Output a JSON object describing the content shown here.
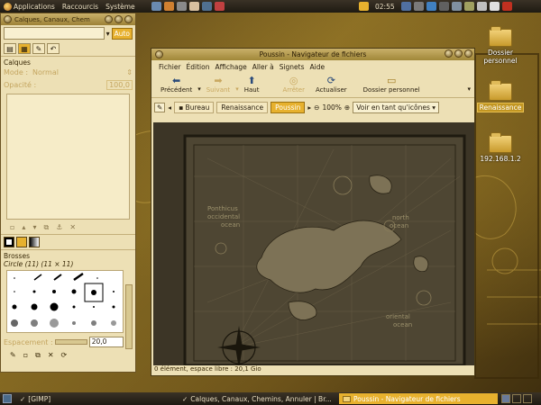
{
  "top_panel": {
    "applications": "Applications",
    "places": "Raccourcis",
    "system": "Système",
    "clock": "02:55"
  },
  "desktop": {
    "icons": [
      {
        "label": "Dossier personnel"
      },
      {
        "label": "Renaissance"
      },
      {
        "label": "192.168.1.2"
      }
    ]
  },
  "gimp_dock": {
    "title": "Calques, Canaux, Chem",
    "auto_label": "Auto",
    "layers_title": "Calques",
    "mode_label": "Mode :",
    "mode_value": "Normal",
    "opacity_label": "Opacité :",
    "opacity_value": "100,0",
    "brushes_title": "Brosses",
    "brush_name": "Circle (11) (11 × 11)",
    "spacing_label": "Espacement :",
    "spacing_value": "20,0"
  },
  "file_manager": {
    "title": "Poussin - Navigateur de fichiers",
    "menu": [
      "Fichier",
      "Édition",
      "Affichage",
      "Aller à",
      "Signets",
      "Aide"
    ],
    "toolbar": {
      "back": "Précédent",
      "forward": "Suivant",
      "up": "Haut",
      "stop": "Arrêter",
      "reload": "Actualiser",
      "home": "Dossier personnel"
    },
    "crumbs": [
      "Bureau",
      "Renaissance",
      "Poussin"
    ],
    "zoom": "100%",
    "view_mode": "Voir en tant qu'icônes",
    "status": "0 élément, espace libre : 20,1 Gio",
    "map_labels": [
      "Ponthicus",
      "occidental",
      "ocean",
      "oriental",
      "north",
      "ocean",
      "ocean",
      "ocean"
    ]
  },
  "bottom_panel": {
    "tasks": [
      {
        "label": "[GIMP]"
      },
      {
        "label": "Calques, Canaux, Chemins, Annuler | Br..."
      },
      {
        "label": "Poussin - Navigateur de fichiers"
      }
    ]
  },
  "colors": {
    "accent": "#e7b12e",
    "panel": "#1e1a12",
    "window_bg": "#ede0b5"
  }
}
